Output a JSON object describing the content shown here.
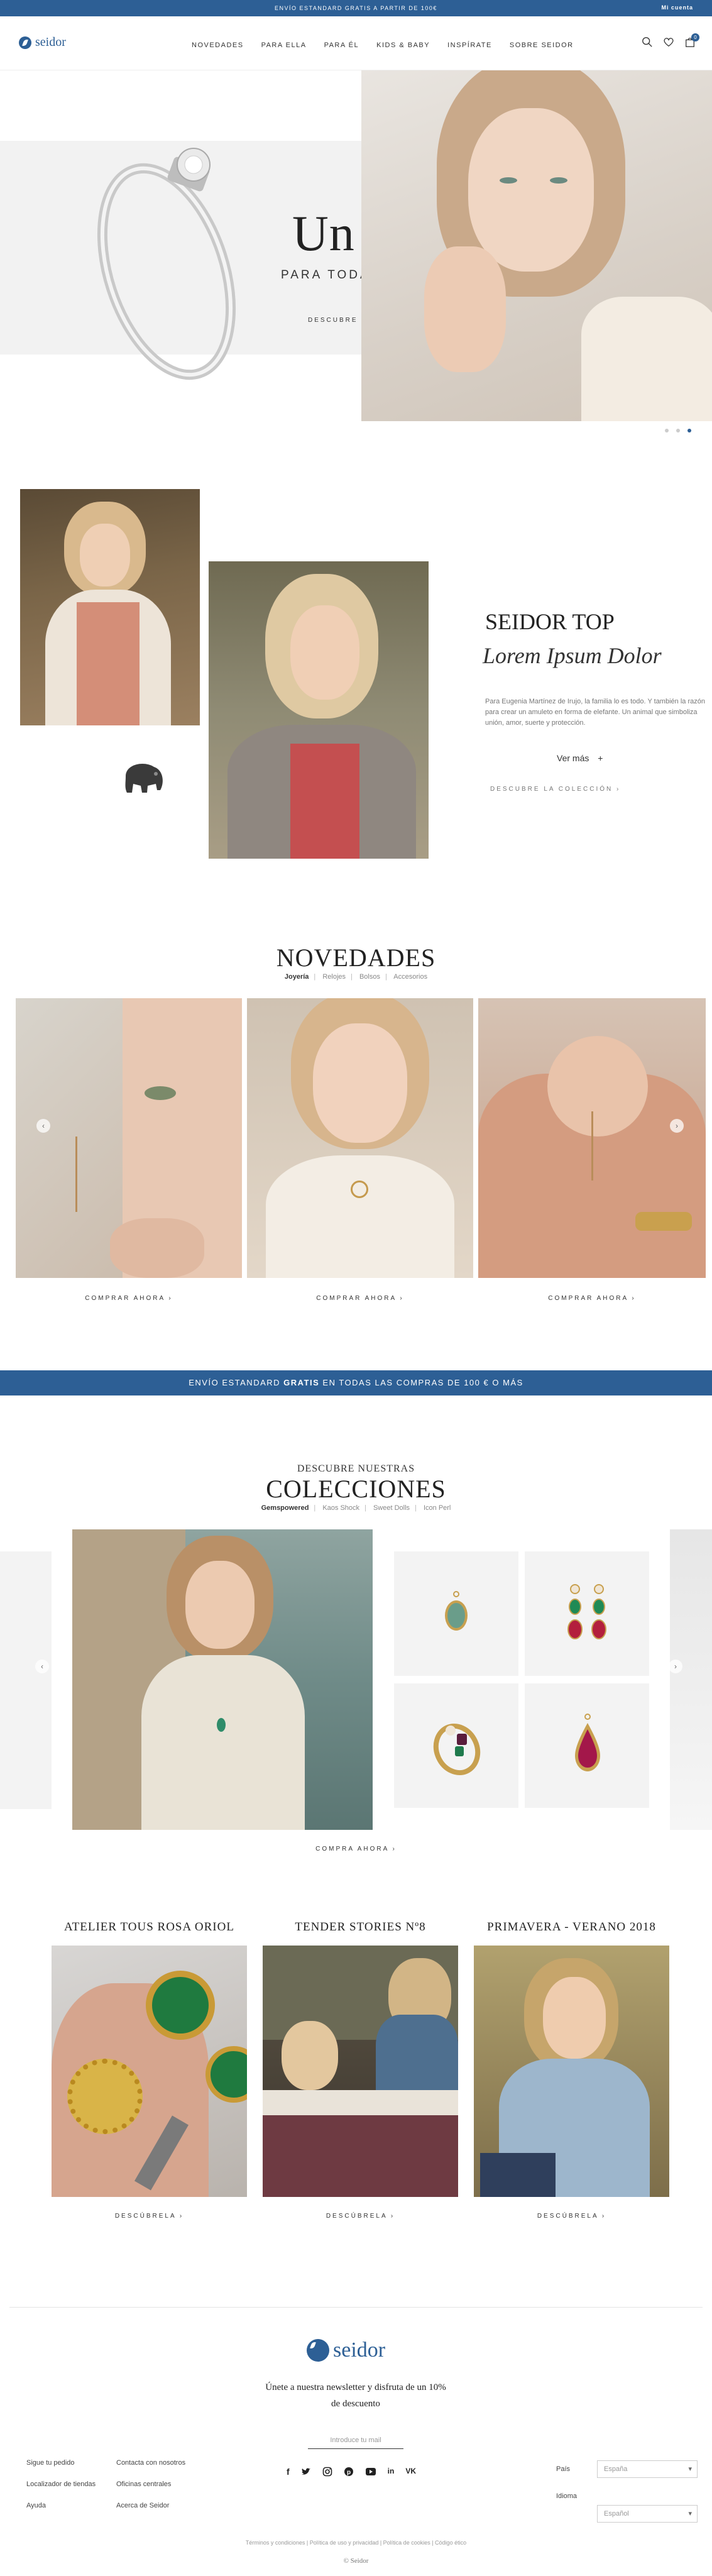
{
  "topbar": {
    "message": "ENVÍO ESTANDARD GRATIS A PARTIR DE 100€",
    "account": "Mi cuenta"
  },
  "header": {
    "brand": "seidor",
    "nav": [
      "NOVEDADES",
      "PARA ELLA",
      "PARA ÉL",
      "KIDS & BABY",
      "INSPÍRATE",
      "SOBRE SEIDOR"
    ],
    "cart_count": "0"
  },
  "hero": {
    "title": "Un día",
    "subtitle": "PARA TODA LA VIDA",
    "cta": "DESCUBRE LA CAMPAÑA"
  },
  "top": {
    "title": "SEIDOR TOP",
    "script": "Lorem Ipsum Dolor",
    "text": "Para Eugenia Martínez de Irujo, la familia lo es todo. Y también la razón para crear un amuleto en forma de elefante. Un animal que simboliza unión, amor, suerte y protección.",
    "more": "Ver más",
    "cta": "DESCUBRE LA COLECCIÓN"
  },
  "novedades": {
    "title": "NOVEDADES",
    "tabs": [
      "Joyería",
      "Relojes",
      "Bolsos",
      "Accesorios"
    ],
    "items": [
      {
        "cta": "COMPRAR AHORA"
      },
      {
        "cta": "COMPRAR AHORA"
      },
      {
        "cta": "COMPRAR AHORA"
      }
    ]
  },
  "shipping_banner": {
    "pre": "ENVÍO ESTANDARD ",
    "bold": "GRATIS",
    "post": " EN TODAS LAS COMPRAS DE 100 € O MÁS"
  },
  "colecciones": {
    "kicker": "DESCUBRE NUESTRAS",
    "title": "COLECCIONES",
    "tabs": [
      "Gemspowered",
      "Kaos Shock",
      "Sweet Dolls",
      "Icon Perl"
    ],
    "cta": "COMPRA AHORA"
  },
  "stories": [
    {
      "title": "ATELIER TOUS ROSA ORIOL",
      "cta": "DESCÚBRELA"
    },
    {
      "title": "TENDER STORIES Nº8",
      "cta": "DESCÚBRELA"
    },
    {
      "title": "PRIMAVERA - VERANO 2018",
      "cta": "DESCÚBRELA"
    }
  ],
  "footer": {
    "brand": "seidor",
    "newsletter": "Únete a nuestra newsletter y disfruta de un 10% de descuento",
    "email_placeholder": "Introduce tu mail",
    "col1": [
      "Sigue tu pedido",
      "Localizador de tiendas",
      "Ayuda"
    ],
    "col2": [
      "Contacta con nosotros",
      "Oficinas centrales",
      "Acerca de Seidor"
    ],
    "social": [
      "facebook-icon",
      "twitter-icon",
      "instagram-icon",
      "pinterest-icon",
      "youtube-icon",
      "linkedin-icon",
      "vk-icon"
    ],
    "country_label": "País",
    "country_value": "España",
    "language_label": "Idioma",
    "language_value": "Español",
    "legal": "Términos y condiciones | Política de uso y privacidad | Política de cookies | Código ético",
    "copyright": "© Seidor"
  },
  "colors": {
    "brand": "#2d5f95"
  }
}
